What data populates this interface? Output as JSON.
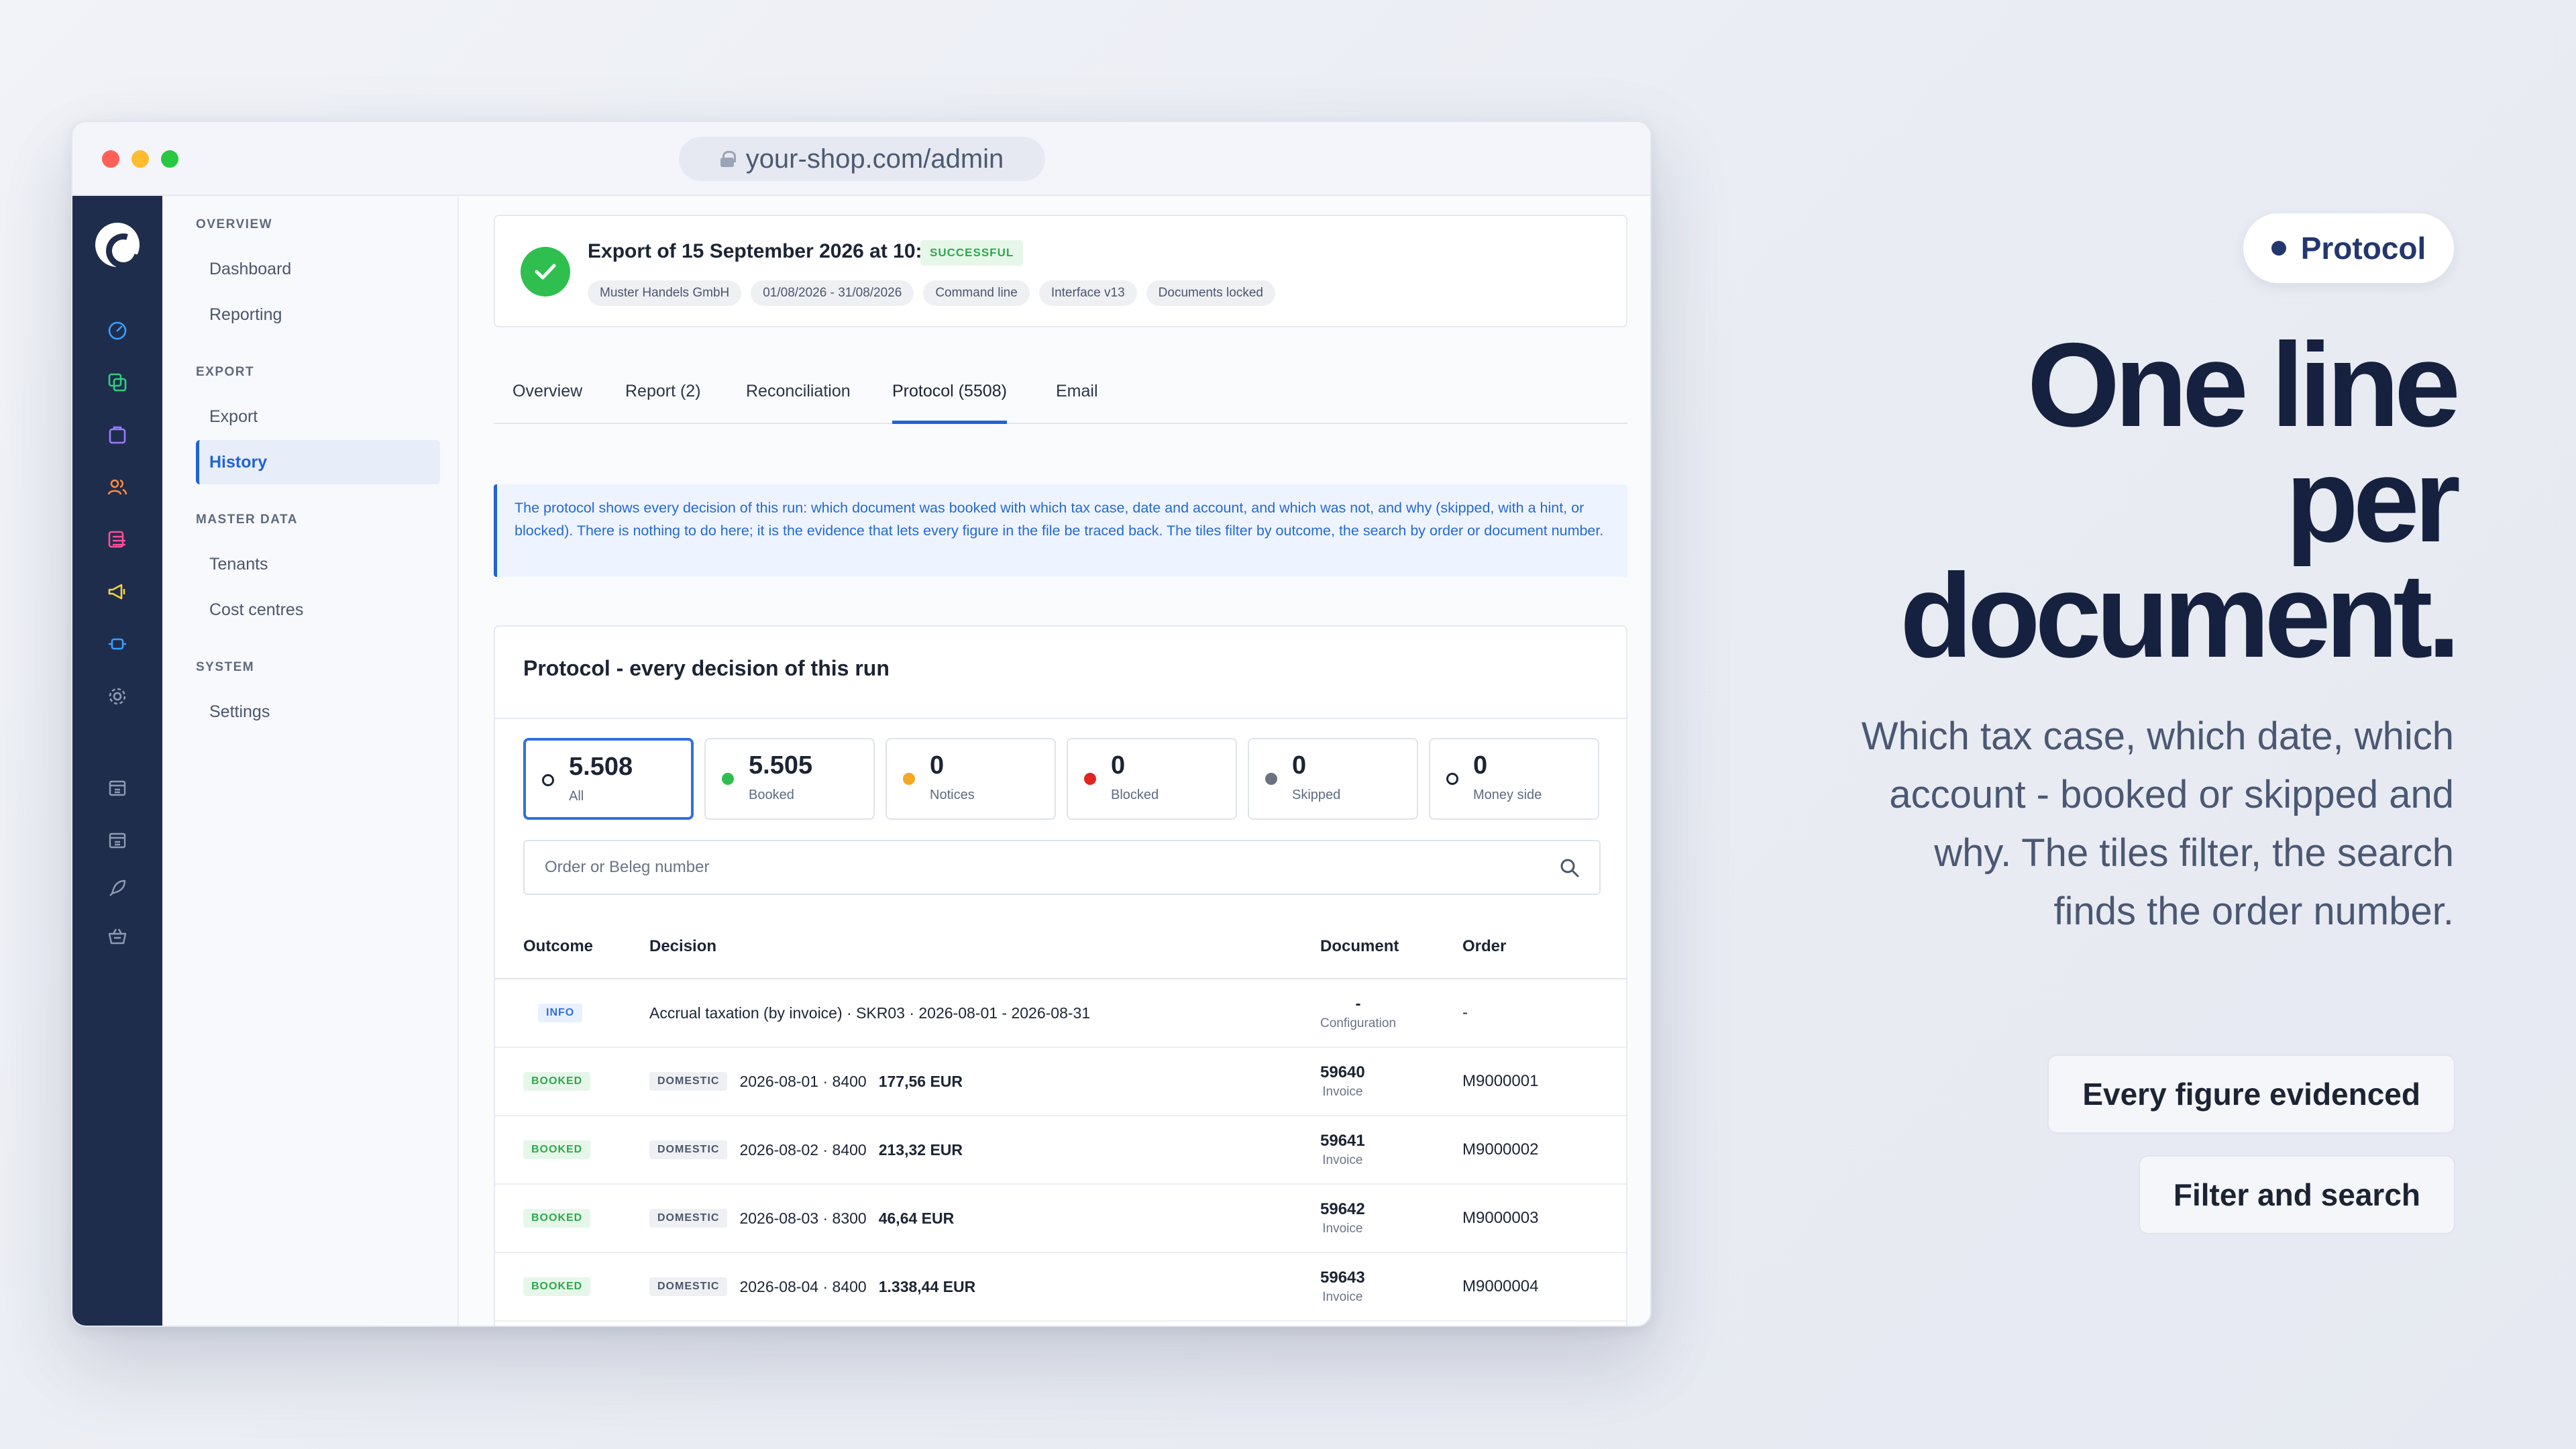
{
  "browser": {
    "url": "your-shop.com/admin"
  },
  "sidebar": {
    "sections": [
      {
        "title": "OVERVIEW",
        "items": [
          "Dashboard",
          "Reporting"
        ]
      },
      {
        "title": "EXPORT",
        "items": [
          "Export",
          "History"
        ]
      },
      {
        "title": "MASTER DATA",
        "items": [
          "Tenants",
          "Cost centres"
        ]
      },
      {
        "title": "SYSTEM",
        "items": [
          "Settings"
        ]
      }
    ],
    "active_item": "History"
  },
  "rail_icons": [
    "dashboard-icon",
    "catalog-icon",
    "orders-icon",
    "customers-icon",
    "content-icon",
    "marketing-icon",
    "extensions-icon",
    "settings-icon",
    "sales-channel-icon",
    "sales-channel-icon",
    "rocket-icon",
    "basket-icon"
  ],
  "export": {
    "title": "Export of 15 September 2026 at 10:56",
    "status": "SUCCESSFUL",
    "tags": [
      "Muster Handels GmbH",
      "01/08/2026 - 31/08/2026",
      "Command line",
      "Interface v13",
      "Documents locked"
    ]
  },
  "tabs": [
    "Overview",
    "Report (2)",
    "Reconciliation",
    "Protocol (5508)",
    "Email"
  ],
  "active_tab": "Protocol (5508)",
  "info_text": "The protocol shows every decision of this run: which document was booked with which tax case, date and account, and which was not, and why (skipped, with a hint, or blocked). There is nothing to do here; it is the evidence that lets every figure in the file be traced back. The tiles filter by outcome, the search by order or document number.",
  "panel": {
    "title": "Protocol - every decision of this run",
    "tiles": [
      {
        "count": "5.508",
        "label": "All",
        "color": "ring"
      },
      {
        "count": "5.505",
        "label": "Booked",
        "color": "#2fbf4e"
      },
      {
        "count": "0",
        "label": "Notices",
        "color": "#f5a623"
      },
      {
        "count": "0",
        "label": "Blocked",
        "color": "#e02424"
      },
      {
        "count": "0",
        "label": "Skipped",
        "color": "#6b7280"
      },
      {
        "count": "0",
        "label": "Money side",
        "color": "ring"
      }
    ],
    "search_placeholder": "Order or Beleg number",
    "columns": [
      "Outcome",
      "Decision",
      "Document",
      "Order"
    ],
    "rows": [
      {
        "outcome": "INFO",
        "outcome_type": "info",
        "tax_case": "",
        "decision": "Accrual taxation (by invoice) · SKR03 · 2026-08-01 - 2026-08-31",
        "amount": "",
        "document": "-",
        "document_type": "Configuration",
        "order": "-"
      },
      {
        "outcome": "BOOKED",
        "outcome_type": "booked",
        "tax_case": "DOMESTIC",
        "decision": "2026-08-01 · 8400",
        "amount": "177,56 EUR",
        "document": "59640",
        "document_type": "Invoice",
        "order": "M9000001"
      },
      {
        "outcome": "BOOKED",
        "outcome_type": "booked",
        "tax_case": "DOMESTIC",
        "decision": "2026-08-02 · 8400",
        "amount": "213,32 EUR",
        "document": "59641",
        "document_type": "Invoice",
        "order": "M9000002"
      },
      {
        "outcome": "BOOKED",
        "outcome_type": "booked",
        "tax_case": "DOMESTIC",
        "decision": "2026-08-03 · 8300",
        "amount": "46,64 EUR",
        "document": "59642",
        "document_type": "Invoice",
        "order": "M9000003"
      },
      {
        "outcome": "BOOKED",
        "outcome_type": "booked",
        "tax_case": "DOMESTIC",
        "decision": "2026-08-04 · 8400",
        "amount": "1.338,44 EUR",
        "document": "59643",
        "document_type": "Invoice",
        "order": "M9000004"
      }
    ]
  },
  "marketing": {
    "chip": "Protocol",
    "headline": [
      "One line",
      "per",
      "document."
    ],
    "subtext": "Which tax case, which date, which account - booked or skipped and why. The tiles filter, the search finds the order number.",
    "buttons": [
      "Every figure evidenced",
      "Filter and search"
    ]
  }
}
